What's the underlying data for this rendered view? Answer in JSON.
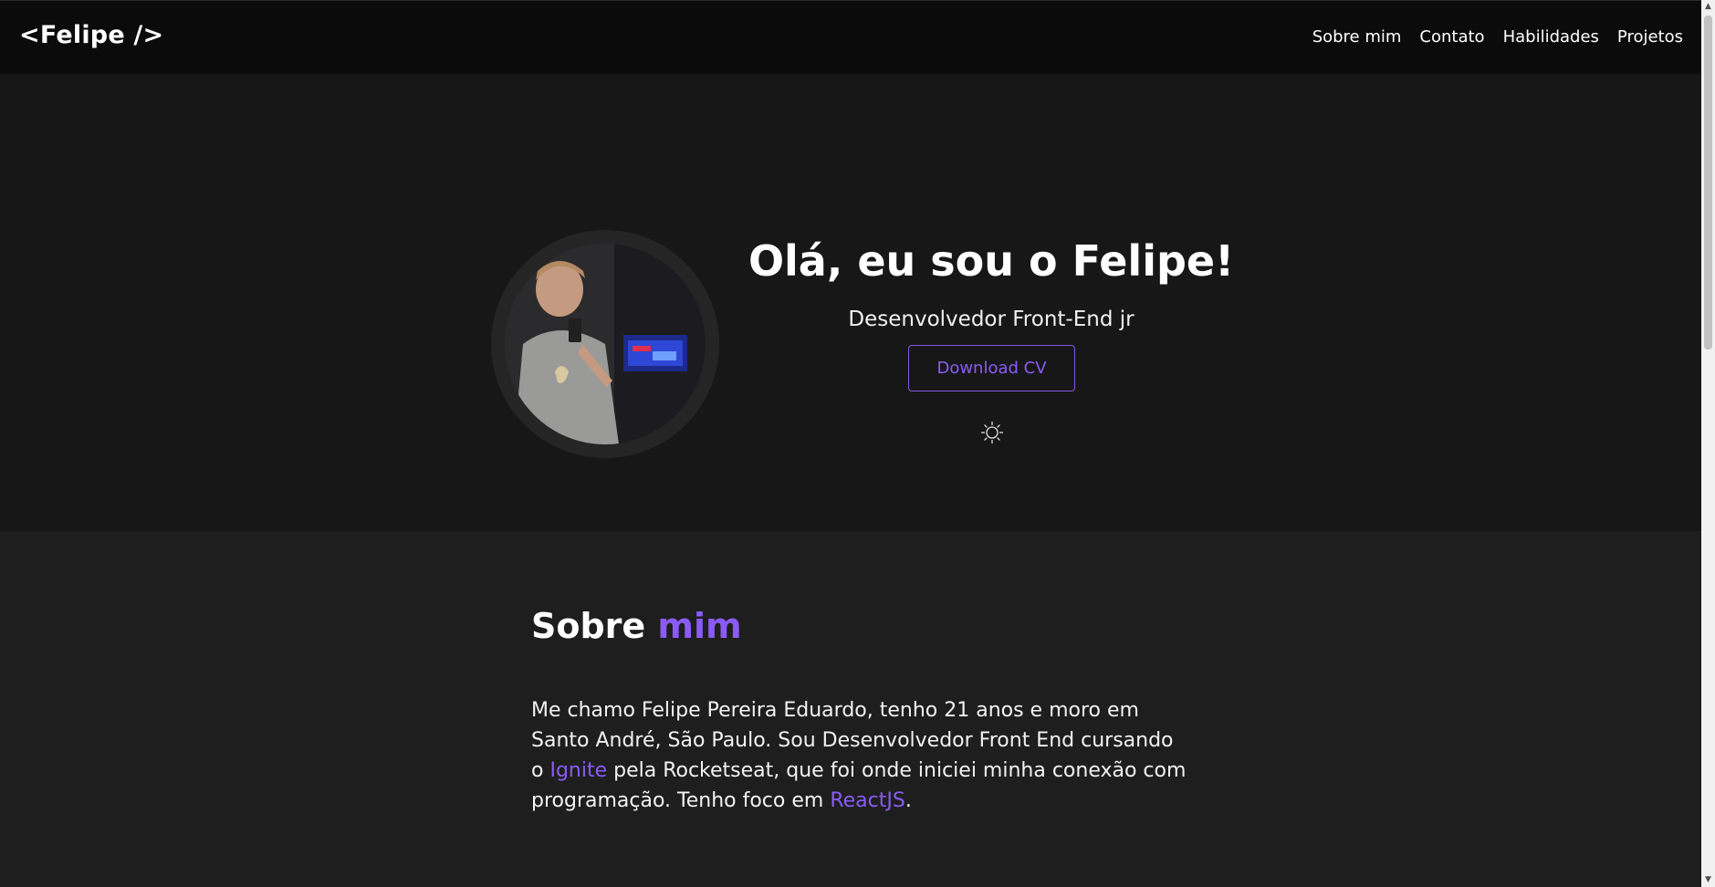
{
  "header": {
    "logo": "<Felipe />",
    "nav": [
      "Sobre mim",
      "Contato",
      "Habilidades",
      "Projetos"
    ]
  },
  "hero": {
    "title": "Olá, eu sou o Felipe!",
    "subtitle": "Desenvolvedor Front-End jr",
    "cta_label": "Download CV",
    "theme_toggle_icon": "sun-icon"
  },
  "about": {
    "title_part1": "Sobre ",
    "title_part2": "mim",
    "text": {
      "p1": "Me chamo Felipe Pereira Eduardo, tenho 21 anos e moro em Santo André, São Paulo. Sou Desenvolvedor Front End cursando o ",
      "link1": "Ignite",
      "p2": " pela Rocketseat, que foi onde iniciei minha conexão com programação. Tenho foco em ",
      "link2": "ReactJS",
      "p3": "."
    }
  },
  "colors": {
    "accent": "#8257e5",
    "header_bg": "#0b0b0b",
    "hero_bg": "#171717",
    "section_bg": "#1e1e1e"
  }
}
